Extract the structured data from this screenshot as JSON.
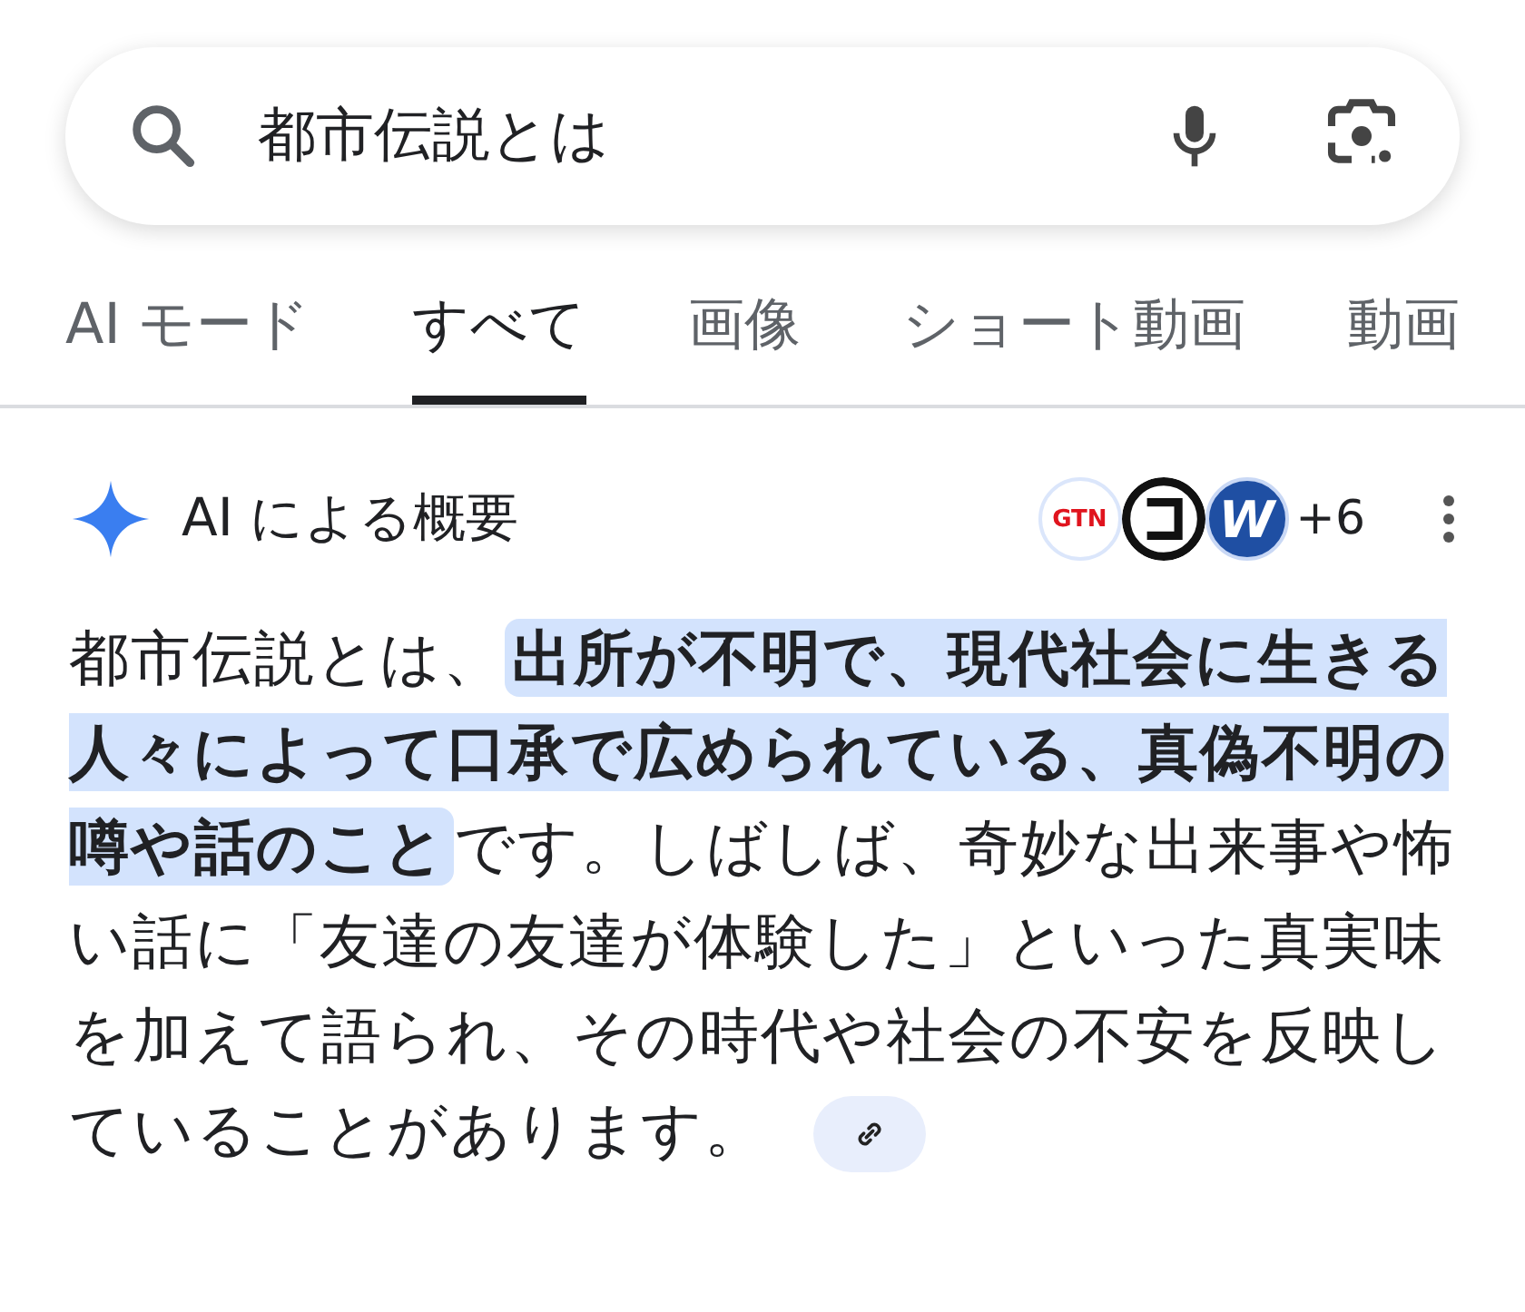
{
  "search": {
    "value": "都市伝説とは"
  },
  "tabs": [
    {
      "label": "AI モード",
      "selected": false
    },
    {
      "label": "すべて",
      "selected": true
    },
    {
      "label": "画像",
      "selected": false
    },
    {
      "label": "ショート動画",
      "selected": false
    },
    {
      "label": "動画",
      "selected": false
    }
  ],
  "overview": {
    "title": "AI による概要",
    "sources": [
      {
        "kind": "text",
        "label": "GTN"
      },
      {
        "kind": "ring"
      },
      {
        "kind": "text",
        "label": "W"
      }
    ],
    "more_sources": "+6",
    "paragraph": {
      "before": "都市伝説とは、",
      "highlight": "出所が不明で、現代社会に生きる人々によって口承で広められている、真偽不明の噂や話のこと",
      "after": "です。しばしば、奇妙な出来事や怖い話に「友達の友達が体験した」といった真実味を加えて語られ、その時代や社会の不安を反映していることがあります。"
    }
  }
}
